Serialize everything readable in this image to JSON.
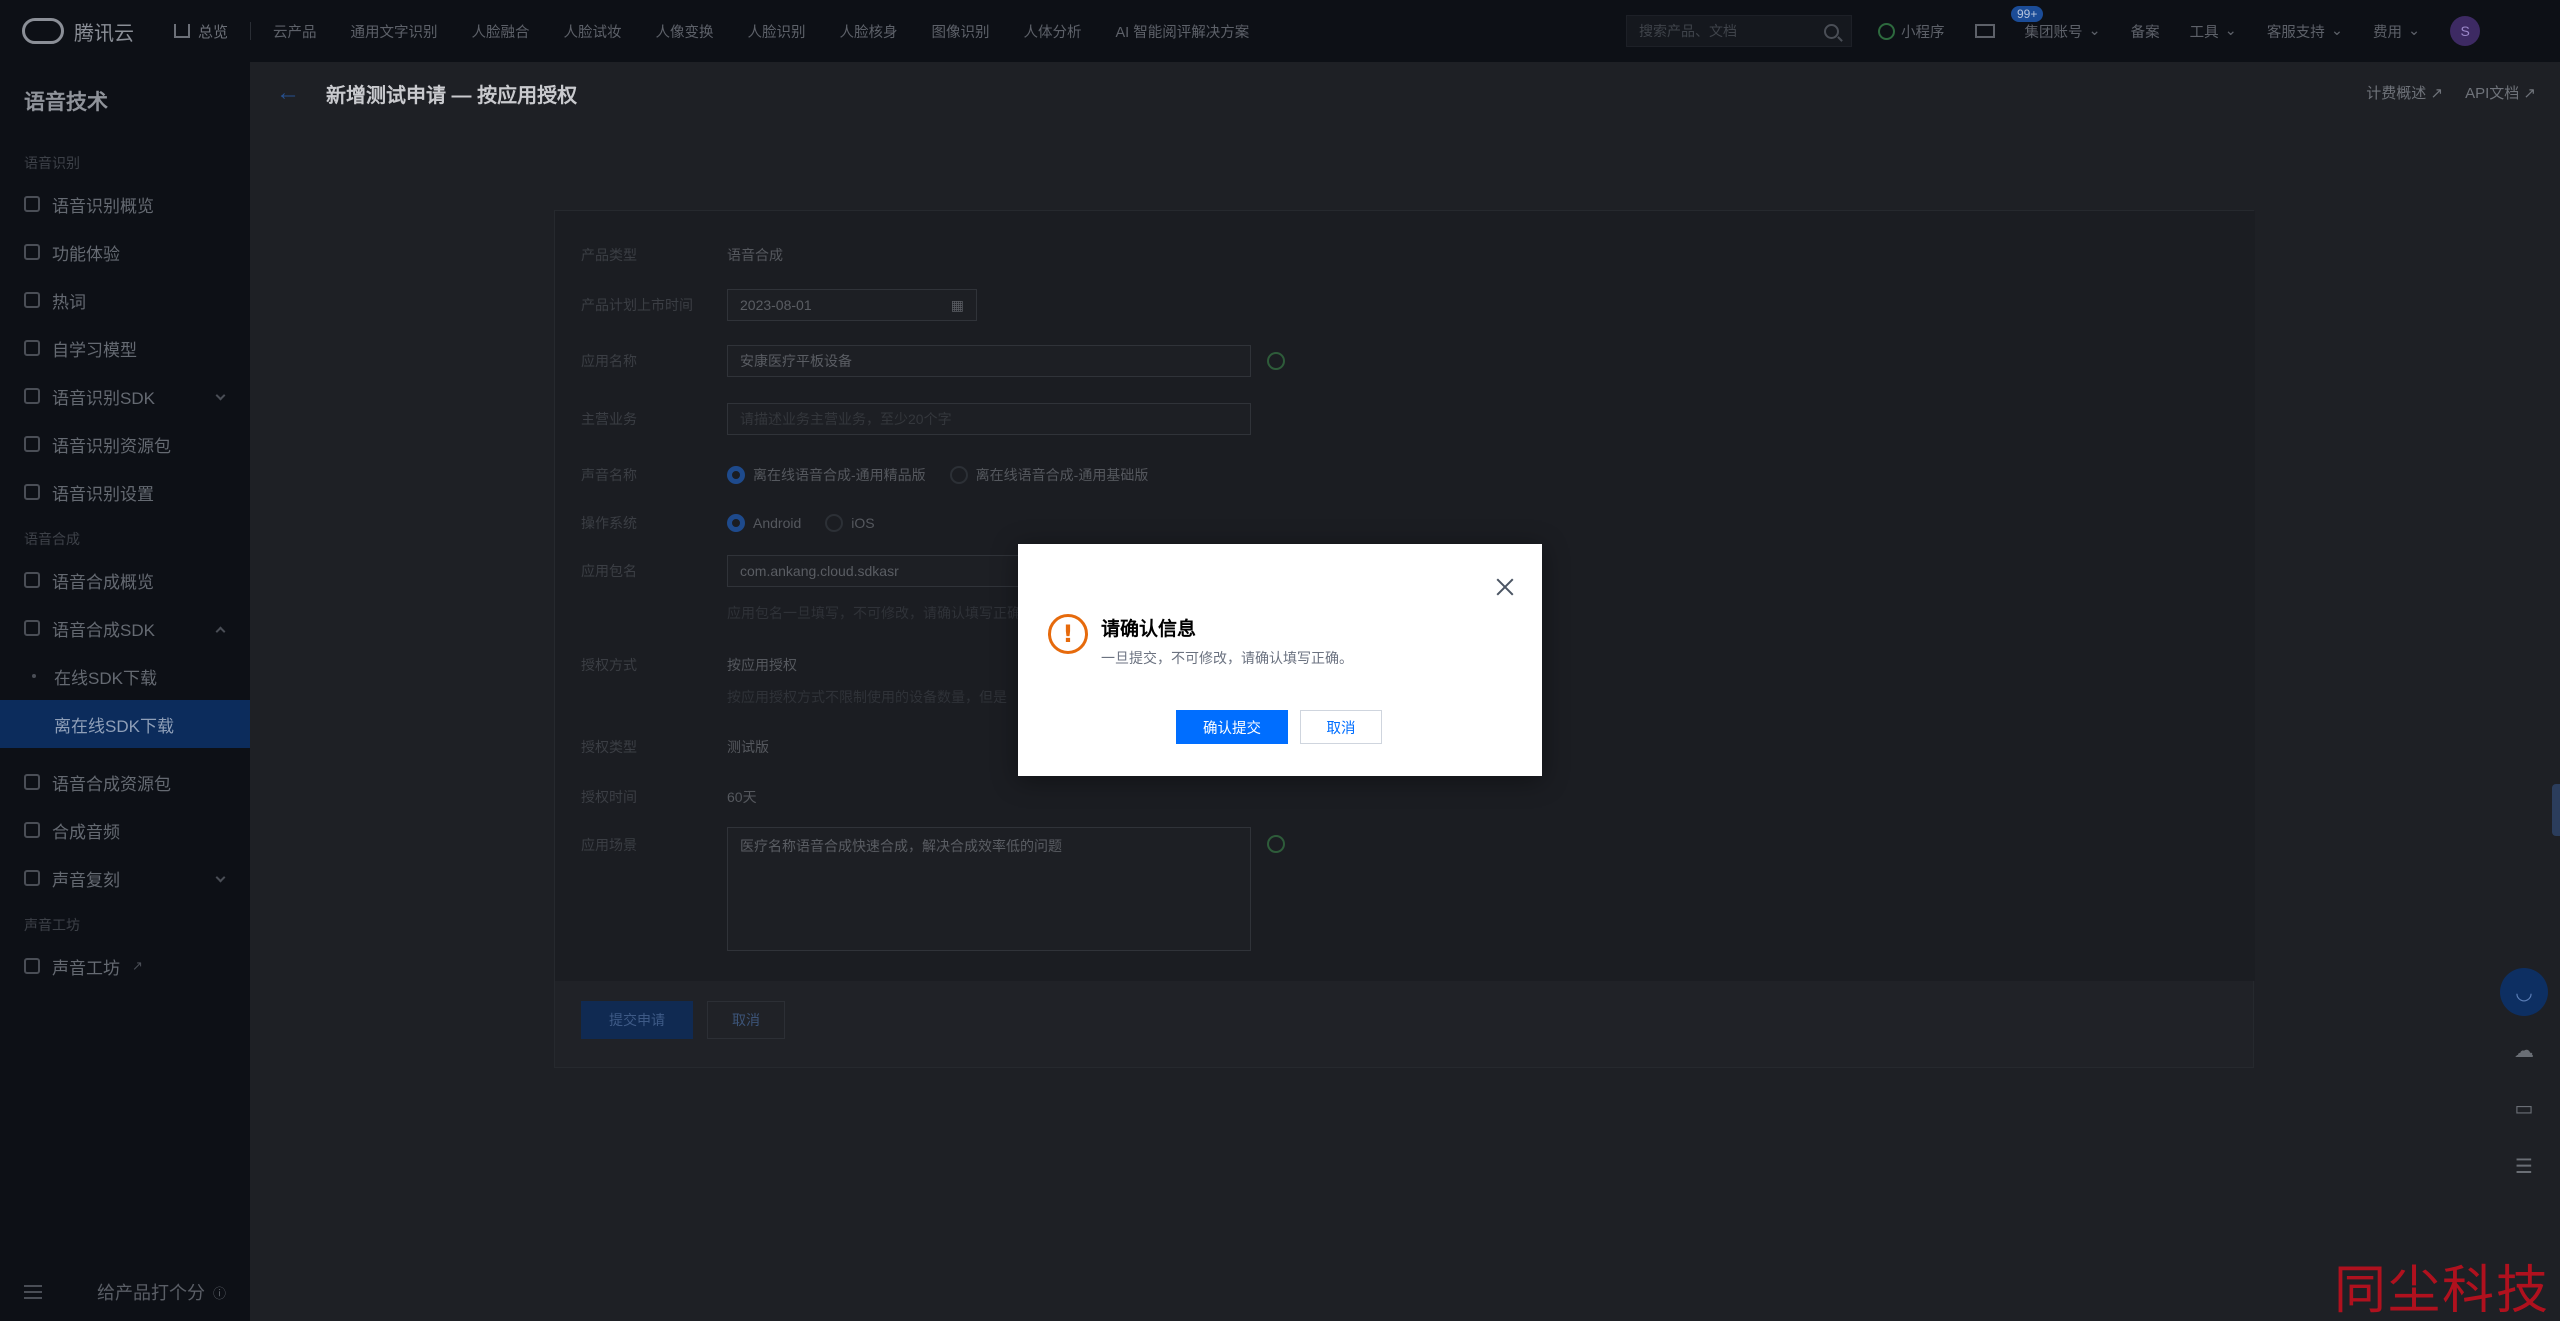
{
  "topnav": {
    "brand": "腾讯云",
    "home": "总览",
    "products": "云产品",
    "links": [
      "通用文字识别",
      "人脸融合",
      "人脸试妆",
      "人像变换",
      "人脸识别",
      "人脸核身",
      "图像识别",
      "人体分析",
      "AI 智能阅评解决方案"
    ],
    "search_placeholder": "搜索产品、文档",
    "mini_program": "小程序",
    "mail_badge": "99+",
    "account": "集团账号",
    "beian": "备案",
    "tools": "工具",
    "support": "客服支持",
    "cost": "费用",
    "avatar": "S"
  },
  "sidebar": {
    "title": "语音技术",
    "groups": [
      {
        "label": "语音识别",
        "items": [
          "语音识别概览",
          "功能体验",
          "热词",
          "自学习模型",
          "语音识别SDK",
          "语音识别资源包",
          "语音识别设置"
        ]
      },
      {
        "label": "语音合成",
        "items": [
          "语音合成概览",
          "语音合成SDK"
        ],
        "subitems": [
          "在线SDK下载",
          "离在线SDK下载"
        ],
        "items_after": [
          "语音合成资源包",
          "合成音频",
          "声音复刻"
        ]
      },
      {
        "label": "声音工坊",
        "items": [
          "声音工坊"
        ]
      }
    ],
    "footer": "给产品打个分"
  },
  "main": {
    "title": "新增测试申请 — 按应用授权",
    "links": [
      "计费概述",
      "API文档"
    ],
    "form": {
      "product_type_label": "产品类型",
      "product_type_value": "语音合成",
      "launch_time_label": "产品计划上市时间",
      "launch_time_value": "2023-08-01",
      "app_name_label": "应用名称",
      "app_name_value": "安康医疗平板设备",
      "business_label": "主营业务",
      "business_placeholder": "请描述业务主营业务，至少20个字",
      "voice_label": "声音名称",
      "voice_opt1": "离在线语音合成-通用精品版",
      "voice_opt2": "离在线语音合成-通用基础版",
      "os_label": "操作系统",
      "os_opt1": "Android",
      "os_opt2": "iOS",
      "package_label": "应用包名",
      "package_value": "com.ankang.cloud.sdkasr",
      "package_hint": "应用包名一旦填写，不可修改，请确认填写正确",
      "auth_method_label": "授权方式",
      "auth_method_value": "按应用授权",
      "auth_method_hint": "按应用授权方式不限制使用的设备数量，但是",
      "auth_type_label": "授权类型",
      "auth_type_value": "测试版",
      "auth_time_label": "授权时间",
      "auth_time_value": "60天",
      "scenario_label": "应用场景",
      "scenario_value": "医疗名称语音合成快速合成，解决合成效率低的问题"
    },
    "submit": "提交申请",
    "cancel": "取消"
  },
  "modal": {
    "title": "请确认信息",
    "description": "一旦提交，不可修改，请确认填写正确。",
    "confirm": "确认提交",
    "cancel": "取消"
  },
  "watermark": "同尘科技",
  "colors": {
    "primary": "#006eff",
    "warning": "#e66a0c",
    "watermark": "#b0111e"
  }
}
